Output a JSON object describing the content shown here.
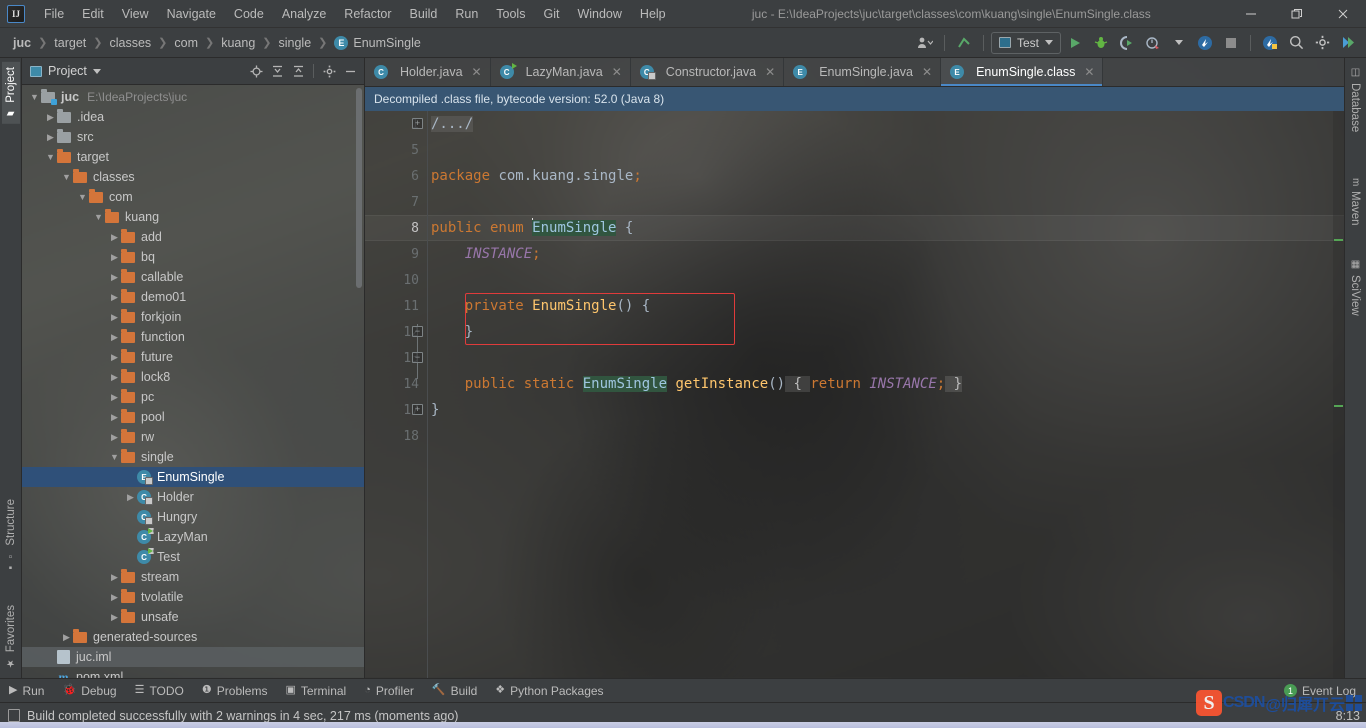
{
  "window": {
    "title": "juc - E:\\IdeaProjects\\juc\\target\\classes\\com\\kuang\\single\\EnumSingle.class",
    "logo": "IJ",
    "minimize": "—",
    "restore": "❐",
    "close": "✕"
  },
  "menu": [
    {
      "label": "File"
    },
    {
      "label": "Edit"
    },
    {
      "label": "View"
    },
    {
      "label": "Navigate"
    },
    {
      "label": "Code"
    },
    {
      "label": "Analyze"
    },
    {
      "label": "Refactor"
    },
    {
      "label": "Build"
    },
    {
      "label": "Run"
    },
    {
      "label": "Tools"
    },
    {
      "label": "Git"
    },
    {
      "label": "Window"
    },
    {
      "label": "Help"
    }
  ],
  "breadcrumb": [
    {
      "label": "juc",
      "bold": true
    },
    {
      "label": "target"
    },
    {
      "label": "classes"
    },
    {
      "label": "com"
    },
    {
      "label": "kuang"
    },
    {
      "label": "single"
    },
    {
      "label": "EnumSingle",
      "icon": "E"
    }
  ],
  "toolbar": {
    "run_config": "Test",
    "icons": [
      "user-avatar-icon",
      "update-project-icon",
      "run-icon",
      "debug-icon",
      "coverage-icon",
      "profiler-icon",
      "ide-assistant-icon",
      "stop-icon",
      "help-icon",
      "search-everywhere-icon",
      "settings-icon",
      "run-all-icon"
    ]
  },
  "left_strip": [
    {
      "label": "Project",
      "active": true
    },
    {
      "label": "Structure",
      "active": false
    },
    {
      "label": "Favorites",
      "active": false
    }
  ],
  "right_strip": [
    {
      "label": "Database"
    },
    {
      "label": "Maven"
    },
    {
      "label": "SciView"
    }
  ],
  "project_panel": {
    "title": "Project",
    "tools": [
      "locate-icon",
      "expand-all-icon",
      "collapse-all-icon",
      "settings-icon",
      "hide-icon"
    ],
    "tree": [
      {
        "depth": 0,
        "label": "juc",
        "path": "E:\\IdeaProjects\\juc",
        "type": "module",
        "arrow": "v",
        "bold": true
      },
      {
        "depth": 1,
        "label": ".idea",
        "type": "folder-grey",
        "arrow": ">"
      },
      {
        "depth": 1,
        "label": "src",
        "type": "folder-grey",
        "arrow": ">"
      },
      {
        "depth": 1,
        "label": "target",
        "type": "folder",
        "arrow": "v"
      },
      {
        "depth": 2,
        "label": "classes",
        "type": "folder",
        "arrow": "v"
      },
      {
        "depth": 3,
        "label": "com",
        "type": "folder",
        "arrow": "v"
      },
      {
        "depth": 4,
        "label": "kuang",
        "type": "folder",
        "arrow": "v"
      },
      {
        "depth": 5,
        "label": "add",
        "type": "folder",
        "arrow": ">"
      },
      {
        "depth": 5,
        "label": "bq",
        "type": "folder",
        "arrow": ">"
      },
      {
        "depth": 5,
        "label": "callable",
        "type": "folder",
        "arrow": ">"
      },
      {
        "depth": 5,
        "label": "demo01",
        "type": "folder",
        "arrow": ">"
      },
      {
        "depth": 5,
        "label": "forkjoin",
        "type": "folder",
        "arrow": ">"
      },
      {
        "depth": 5,
        "label": "function",
        "type": "folder",
        "arrow": ">"
      },
      {
        "depth": 5,
        "label": "future",
        "type": "folder",
        "arrow": ">"
      },
      {
        "depth": 5,
        "label": "lock8",
        "type": "folder",
        "arrow": ">"
      },
      {
        "depth": 5,
        "label": "pc",
        "type": "folder",
        "arrow": ">"
      },
      {
        "depth": 5,
        "label": "pool",
        "type": "folder",
        "arrow": ">"
      },
      {
        "depth": 5,
        "label": "rw",
        "type": "folder",
        "arrow": ">"
      },
      {
        "depth": 5,
        "label": "single",
        "type": "folder",
        "arrow": "v"
      },
      {
        "depth": 6,
        "label": "EnumSingle",
        "type": "enum-class",
        "arrow": "",
        "selected": true
      },
      {
        "depth": 6,
        "label": "Holder",
        "type": "class-lock",
        "arrow": ">"
      },
      {
        "depth": 6,
        "label": "Hungry",
        "type": "class-lock",
        "arrow": ""
      },
      {
        "depth": 6,
        "label": "LazyMan",
        "type": "class-run",
        "arrow": ""
      },
      {
        "depth": 6,
        "label": "Test",
        "type": "class-run",
        "arrow": ""
      },
      {
        "depth": 5,
        "label": "stream",
        "type": "folder",
        "arrow": ">"
      },
      {
        "depth": 5,
        "label": "tvolatile",
        "type": "folder",
        "arrow": ">"
      },
      {
        "depth": 5,
        "label": "unsafe",
        "type": "folder",
        "arrow": ">"
      },
      {
        "depth": 2,
        "label": "generated-sources",
        "type": "folder",
        "arrow": ">"
      },
      {
        "depth": 1,
        "label": "juc.iml",
        "type": "file-iml",
        "arrow": "",
        "highlight": true
      },
      {
        "depth": 1,
        "label": "pom.xml",
        "type": "file-maven",
        "arrow": ""
      }
    ]
  },
  "editor": {
    "tabs": [
      {
        "label": "Holder.java",
        "icon": "C",
        "active": false
      },
      {
        "label": "LazyMan.java",
        "icon": "C",
        "active": false
      },
      {
        "label": "Constructor.java",
        "icon": "C",
        "active": false
      },
      {
        "label": "EnumSingle.java",
        "icon": "E",
        "active": false
      },
      {
        "label": "EnumSingle.class",
        "icon": "E",
        "active": true
      }
    ],
    "notice": "Decompiled .class file, bytecode version: 52.0 (Java 8)",
    "line_numbers": [
      "1",
      "5",
      "6",
      "7",
      "8",
      "9",
      "10",
      "11",
      "12",
      "13",
      "14",
      "17",
      "18"
    ],
    "current_line": "8",
    "code_lines": [
      {
        "num": "1",
        "text": "/.../"
      },
      {
        "num": "5",
        "text": ""
      },
      {
        "num": "6",
        "text": "package com.kuang.single;"
      },
      {
        "num": "7",
        "text": ""
      },
      {
        "num": "8",
        "text": "public enum EnumSingle {"
      },
      {
        "num": "9",
        "text": "    INSTANCE;"
      },
      {
        "num": "10",
        "text": ""
      },
      {
        "num": "11",
        "text": "    private EnumSingle() {"
      },
      {
        "num": "12",
        "text": "    }"
      },
      {
        "num": "13",
        "text": ""
      },
      {
        "num": "14",
        "text": "    public static EnumSingle getInstance() { return INSTANCE; }"
      },
      {
        "num": "17",
        "text": "}"
      },
      {
        "num": "18",
        "text": ""
      }
    ],
    "colors": {
      "keyword": "#CC7832",
      "identifier": "#A9B7C6",
      "method": "#FFC66D",
      "constant": "#9876AA",
      "highlight_identifier_bg": "#31553F",
      "annotation_box": "#E03B3B",
      "notice_bg": "#385673"
    }
  },
  "bottom_tools": [
    {
      "label": "Run",
      "icon": "run-icon"
    },
    {
      "label": "Debug",
      "icon": "debug-icon"
    },
    {
      "label": "TODO",
      "icon": "todo-icon"
    },
    {
      "label": "Problems",
      "icon": "problems-icon"
    },
    {
      "label": "Terminal",
      "icon": "terminal-icon"
    },
    {
      "label": "Profiler",
      "icon": "profiler-icon"
    },
    {
      "label": "Build",
      "icon": "build-icon"
    },
    {
      "label": "Python Packages",
      "icon": "python-packages-icon"
    }
  ],
  "event_log": {
    "label": "Event Log",
    "count": "1"
  },
  "status": {
    "message": "Build completed successfully with 2 warnings in 4 sec, 217 ms (moments ago)",
    "clock": "8:13"
  },
  "watermark": {
    "mark": "S",
    "text": "CSDN",
    "cn": "@归犀丌云"
  }
}
